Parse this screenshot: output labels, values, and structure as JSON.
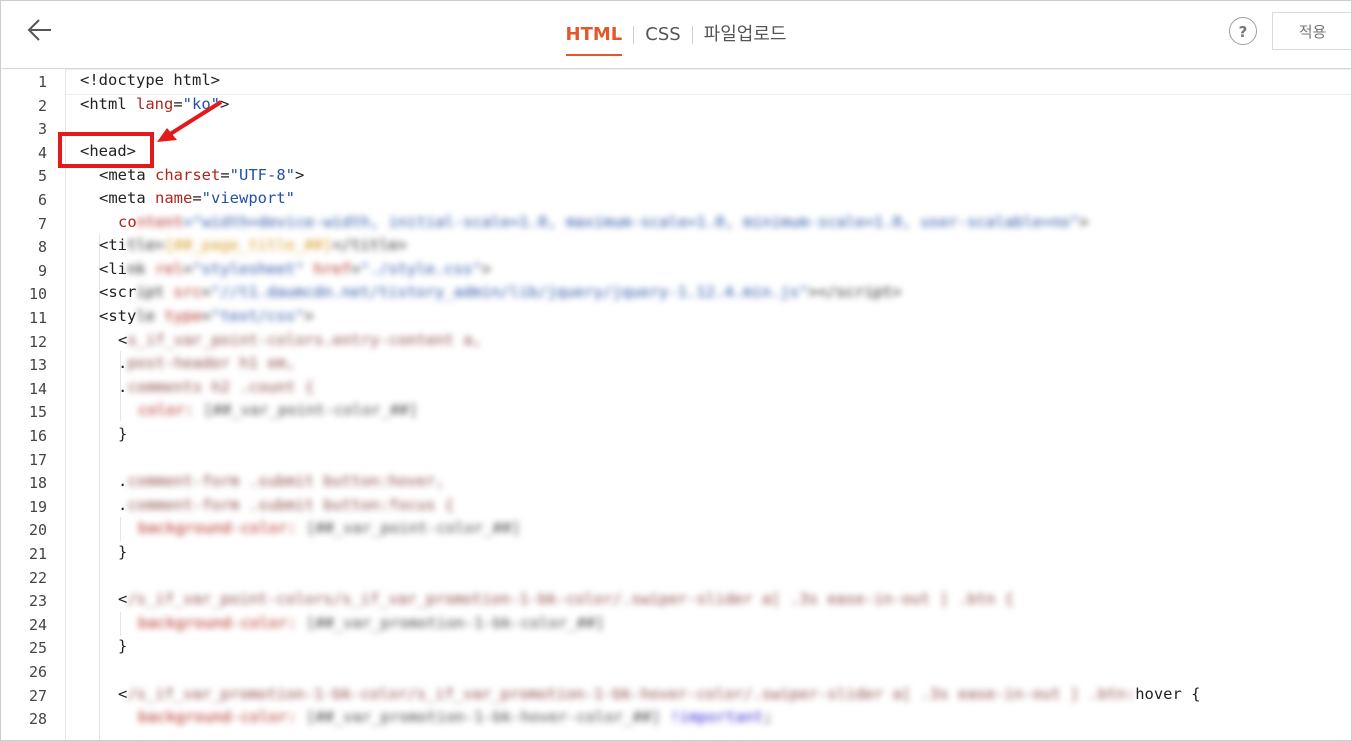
{
  "header": {
    "tabs": [
      {
        "label": "HTML",
        "active": true
      },
      {
        "label": "CSS",
        "active": false
      },
      {
        "label": "파일업로드",
        "active": false
      }
    ],
    "help_label": "?",
    "apply_label": "적용"
  },
  "colors": {
    "accent": "#e2582b",
    "annotation": "#e3191c",
    "attribute": "#b0261d",
    "string": "#2450a6"
  },
  "editor": {
    "line_numbers": [
      "1",
      "2",
      "3",
      "4",
      "5",
      "6",
      "7",
      "8",
      "9",
      "10",
      "11",
      "12",
      "13",
      "14",
      "15",
      "16",
      "17",
      "18",
      "19",
      "20",
      "21",
      "22",
      "23",
      "24",
      "25",
      "26",
      "27",
      "28"
    ],
    "lines": {
      "l1": "<!doctype html>",
      "l2_tag": "<html ",
      "l2_attr": "lang",
      "l2_eq": "=",
      "l2_str": "\"ko\"",
      "l2_close": ">",
      "l4": "<head>",
      "l5_tag": "<meta ",
      "l5_attr": "charset",
      "l5_str": "\"UTF-8\"",
      "l6_tag": "<meta ",
      "l6_attr": "name",
      "l6_str": "\"viewport\"",
      "l7_visible": "co",
      "l8_visible": "<ti",
      "l9_visible": "<li",
      "l10_visible": "<scr",
      "l11_visible": "<sty",
      "l12_visible": "<",
      "l13_visible": ".",
      "l14_visible": ".",
      "l16": "}",
      "l18_visible": ".",
      "l19_visible": ".",
      "l21": "}",
      "l23_visible": "<",
      "l25": "}",
      "l27_visible": "<",
      "l27_end": "hover {"
    }
  }
}
